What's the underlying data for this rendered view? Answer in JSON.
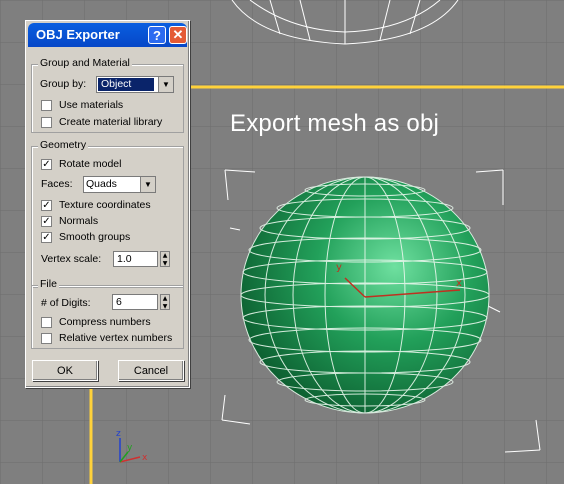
{
  "viewport": {
    "overlay_text": "Export mesh as obj",
    "colors": {
      "background": "#7f7f7f",
      "grid": "#6e6e6e",
      "sphere": "#1e8f4e",
      "active_border": "#ffd23a"
    },
    "axis_labels": {
      "x": "x",
      "y": "y",
      "z": "z"
    }
  },
  "dialog": {
    "title": "OBJ Exporter",
    "help_label": "?",
    "close_label": "✕",
    "group_material": {
      "label": "Group and Material",
      "group_by_label": "Group by:",
      "group_by_value": "Object",
      "use_materials": {
        "label": "Use materials",
        "checked": false
      },
      "create_material_library": {
        "label": "Create material library",
        "checked": false
      }
    },
    "geometry": {
      "label": "Geometry",
      "rotate_model": {
        "label": "Rotate model",
        "checked": true
      },
      "faces_label": "Faces:",
      "faces_value": "Quads",
      "texture_coordinates": {
        "label": "Texture coordinates",
        "checked": true
      },
      "normals": {
        "label": "Normals",
        "checked": true
      },
      "smooth_groups": {
        "label": "Smooth groups",
        "checked": true
      },
      "vertex_scale_label": "Vertex scale:",
      "vertex_scale_value": "1.0"
    },
    "file": {
      "label": "File",
      "digits_label": "# of Digits:",
      "digits_value": "6",
      "compress_numbers": {
        "label": "Compress numbers",
        "checked": false
      },
      "relative_vertex_numbers": {
        "label": "Relative vertex numbers",
        "checked": false
      }
    },
    "ok_label": "OK",
    "cancel_label": "Cancel"
  }
}
